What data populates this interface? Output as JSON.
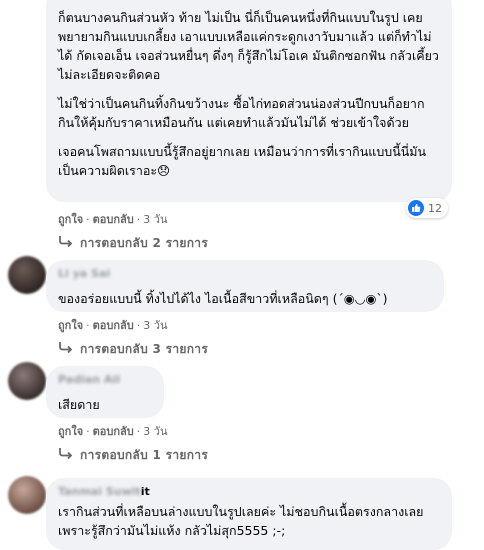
{
  "comments": [
    {
      "paragraphs": [
        "ก็ตนบางคนกินส่วนหัว ท้าย ไม่เป็น นี่ก็เป็นคนหนึ่งที่กินแบบในรูป เคยพยายามกินแบบเกลี้ยง เอาแบบเหลือแค่กระดูกเงาวับมาแล้ว แต่ก็ทำไม่ได้ กัดเจอเอ็น เจอส่วนหยื่นๆ ดึ่งๆ ก็รู้สึกไม่โอเค มันติกซอกฟัน กลัวเคี้ยวไม่ละเอียดจะติดคอ",
        "ไม่ใช่ว่าเป็นคนกินทิ้งกินขว้างนะ ซื้อไก่ทอดส่วนน่องส่วนปีกบนก็อยากกินให้คุ้มกับราคาเหมือนกัน แต่เคยทำแล้วมันไม่ได้ ช่วยเข้าใจด้วย",
        "เจอคนโพสถามแบบนี้รู้สึกอยู่ยากเลย เหมือนว่าการที่เรากินแบบนี้นี่มันเป็นความผิดเราอะ😞"
      ],
      "like_label": "ถูกใจ",
      "reply_label": "ตอบกลับ",
      "time": "3 วัน",
      "reaction_count": "12",
      "replies_label": "การตอบกลับ 2 รายการ"
    },
    {
      "author": "Li ya Sai",
      "paragraphs": [
        "ของอร่อยแบบนี้ ทิ้งไปได้ไง ไอเนื้อสีขาวที่เหลือนิดๆ (´◉◡◉`)"
      ],
      "like_label": "ถูกใจ",
      "reply_label": "ตอบกลับ",
      "time": "3 วัน",
      "replies_label": "การตอบกลับ 3 รายการ"
    },
    {
      "author": "Padian Ail",
      "paragraphs": [
        "เสียดาย"
      ],
      "like_label": "ถูกใจ",
      "reply_label": "ตอบกลับ",
      "time": "3 วัน",
      "replies_label": "การตอบกลับ 1 รายการ"
    },
    {
      "author": "Tanmai Suwit",
      "author_suffix": "it",
      "paragraphs": [
        "เรากินส่วนที่เหลือบนล่างแบบในรูปเลยค่ะ ไม่ชอบกินเนื้อตรงกลางเลย เพราะรู้สึกว่ามันไม่แห้ง กลัวไม่สุก5555 ;-;"
      ]
    }
  ],
  "colors": {
    "bubble": "#f0f2f5",
    "meta": "#65676b",
    "like": "#1877f2"
  }
}
